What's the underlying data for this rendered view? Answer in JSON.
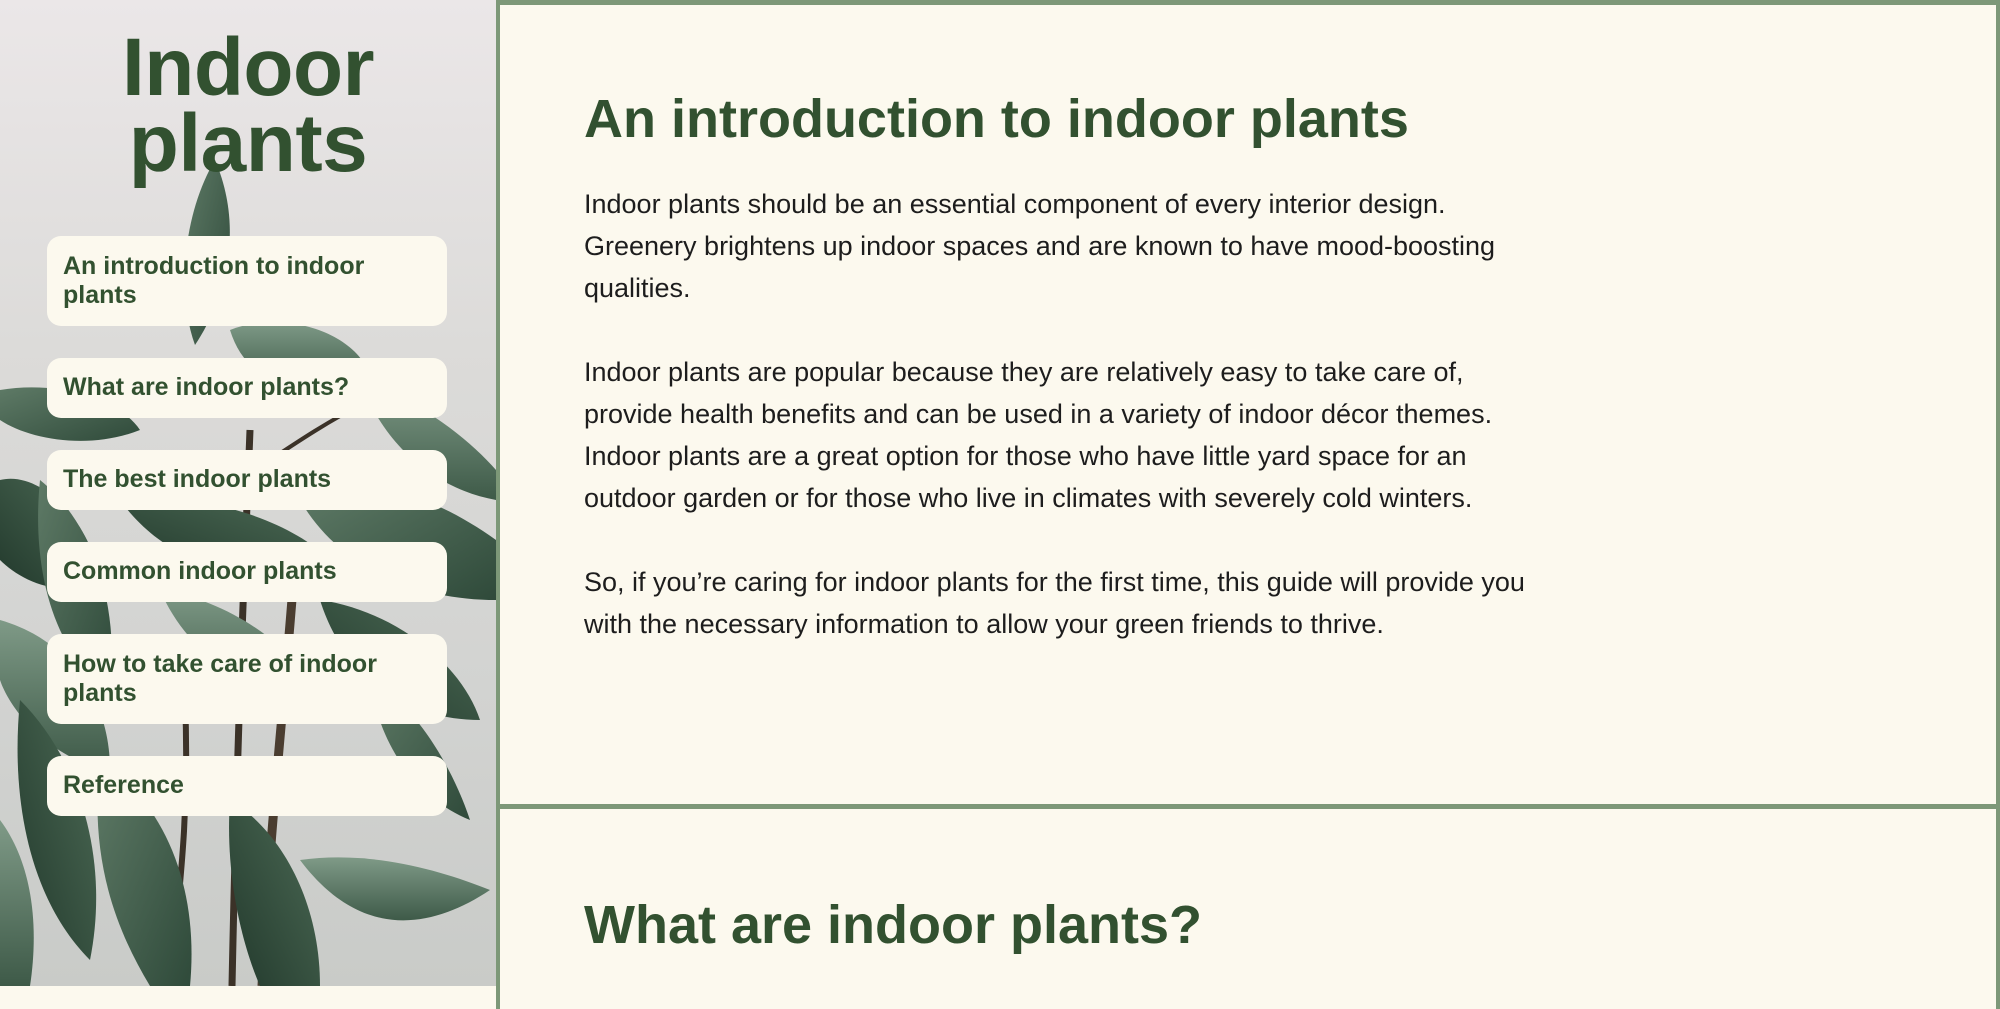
{
  "sidebar": {
    "title_line1": "Indoor",
    "title_line2": "plants",
    "nav_items": [
      "An introduction to indoor plants",
      "What are indoor plants?",
      "The best indoor plants",
      "Common indoor plants",
      "How to take care of indoor plants",
      "Reference"
    ]
  },
  "sections": [
    {
      "heading": "An introduction to indoor plants",
      "paragraphs": [
        "Indoor plants should be an essential component of every interior design. Greenery brightens up indoor spaces and are known to have mood-boosting qualities.",
        "Indoor plants are popular because they are relatively easy to take care of, provide health benefits and can be used in a variety of indoor décor themes. Indoor plants are a great option for those who have little yard space for an outdoor garden or for those who live in climates with severely cold winters.",
        "So, if you’re caring for indoor plants for the first time, this guide will provide you with the necessary information to allow your green friends to thrive."
      ]
    },
    {
      "heading": "What are indoor plants?"
    }
  ],
  "colors": {
    "accent_green": "#325130",
    "border_green": "#7d9878",
    "cream": "#fcf9ee"
  },
  "icons": {
    "sidebar_image": "plant-leaves-photo"
  }
}
